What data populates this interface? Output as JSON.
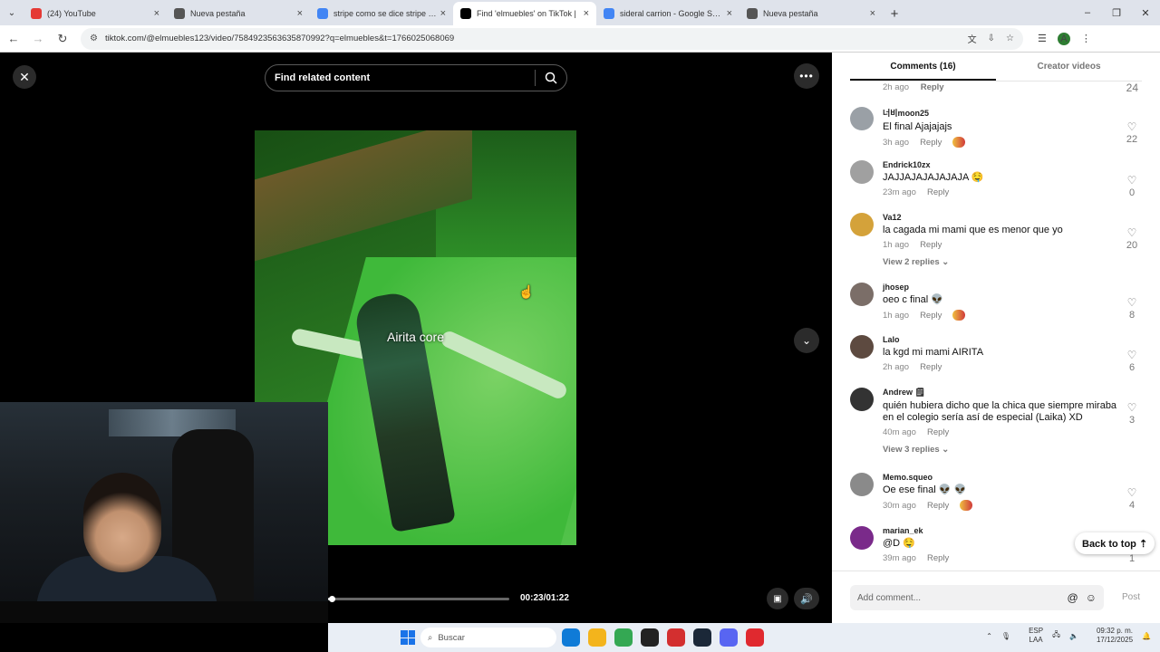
{
  "browser": {
    "tabs": [
      {
        "title": "(24) YouTube",
        "color": "#e53935",
        "active": false
      },
      {
        "title": "Nueva pestaña",
        "color": "#555555",
        "active": false
      },
      {
        "title": "stripe como se dice stripe - Goo",
        "color": "#4285f4",
        "active": false
      },
      {
        "title": "Find 'elmuebles' on TikTok |",
        "color": "#000000",
        "active": true
      },
      {
        "title": "sideral carrion - Google Search",
        "color": "#4285f4",
        "active": false
      },
      {
        "title": "Nueva pestaña",
        "color": "#555555",
        "active": false
      }
    ],
    "url": "tiktok.com/@elmuebles123/video/7584923563635870992?q=elmuebles&t=1766025068069",
    "profile_initial": "A"
  },
  "video": {
    "search_placeholder": "Find related content",
    "caption": "Airita core",
    "timecode": "00:23/01:22",
    "progress": 0.02
  },
  "comments": {
    "tab_comments": "Comments (16)",
    "tab_creator": "Creator videos",
    "top_partial": {
      "time": "2h ago",
      "reply": "Reply",
      "likes": "24"
    },
    "items": [
      {
        "user": "너비moon25",
        "text": "El final Ajajajajs",
        "time": "3h ago",
        "reply": "Reply",
        "likes": "22",
        "creator_liked": true,
        "avatar": "#9aa0a6",
        "view_replies": ""
      },
      {
        "user": "Endrick10zx",
        "text": "JAJJAJAJAJAJAJA 🤤",
        "time": "23m ago",
        "reply": "Reply",
        "likes": "0",
        "creator_liked": false,
        "avatar": "#a0a0a0",
        "view_replies": ""
      },
      {
        "user": "Va12",
        "text": "la cagada mi mami que es menor que yo",
        "time": "1h ago",
        "reply": "Reply",
        "likes": "20",
        "creator_liked": false,
        "avatar": "#d4a23a",
        "view_replies": "View 2 replies ⌄"
      },
      {
        "user": "jhosep",
        "text": "oeo c final 👽",
        "time": "1h ago",
        "reply": "Reply",
        "likes": "8",
        "creator_liked": true,
        "avatar": "#7b6e68",
        "view_replies": ""
      },
      {
        "user": "Lalo",
        "text": "la kgd mi mami AIRITA",
        "time": "2h ago",
        "reply": "Reply",
        "likes": "6",
        "creator_liked": false,
        "avatar": "#5d4a40",
        "view_replies": ""
      },
      {
        "user": "Andrew 🗒",
        "text": "quién hubiera dicho que la chica que siempre miraba en el colegio sería así de especial (Laika) XD",
        "time": "40m ago",
        "reply": "Reply",
        "likes": "3",
        "creator_liked": false,
        "avatar": "#333333",
        "view_replies": "View 3 replies ⌄"
      },
      {
        "user": "Memo.squeo",
        "text": "Oe ese final 👽 👽",
        "time": "30m ago",
        "reply": "Reply",
        "likes": "4",
        "creator_liked": true,
        "avatar": "#8a8a8a",
        "view_replies": ""
      },
      {
        "user": "marian_ek",
        "text": "@D 🤤",
        "time": "39m ago",
        "reply": "Reply",
        "likes": "1",
        "creator_liked": false,
        "avatar": "#7a2a8a",
        "view_replies": ""
      }
    ],
    "back_to_top": "Back to top ⇡",
    "add_placeholder": "Add comment...",
    "post_label": "Post"
  },
  "taskbar": {
    "search_placeholder": "Buscar",
    "lang_line1": "ESP",
    "lang_line2": "LAA",
    "time": "09:32 p. m.",
    "date": "17/12/2025",
    "apps": [
      {
        "name": "edge",
        "color": "#0f7bd7"
      },
      {
        "name": "files",
        "color": "#f3b41c"
      },
      {
        "name": "chrome",
        "color": "#34a853"
      },
      {
        "name": "obs",
        "color": "#222222"
      },
      {
        "name": "app-red",
        "color": "#d32f2f"
      },
      {
        "name": "steam",
        "color": "#1b2838"
      },
      {
        "name": "discord",
        "color": "#5865f2"
      },
      {
        "name": "opera",
        "color": "#e0292f"
      }
    ]
  }
}
